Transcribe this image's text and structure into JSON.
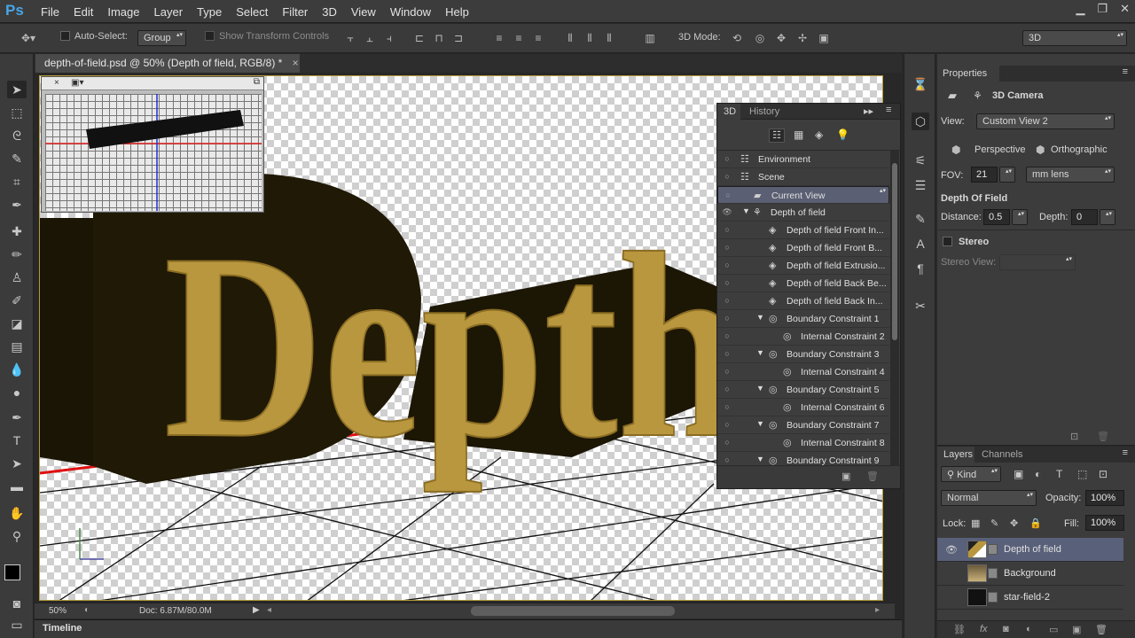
{
  "app": {
    "logo": "Ps"
  },
  "menu": [
    "File",
    "Edit",
    "Image",
    "Layer",
    "Type",
    "Select",
    "Filter",
    "3D",
    "View",
    "Window",
    "Help"
  ],
  "window_controls": {
    "minimize": "▁",
    "restore": "❐",
    "close": "✕"
  },
  "options_bar": {
    "auto_select_label": "Auto-Select:",
    "auto_select_value": "Group",
    "show_transform_label": "Show Transform Controls",
    "mode_label": "3D Mode:",
    "workspace": "3D"
  },
  "document": {
    "tab_title": "depth-of-field.psd @ 50% (Depth of field, RGB/8) *",
    "tab_close": "×",
    "zoom": "50%",
    "doc_info": "Doc: 6.87M/80.0M",
    "canvas_text": "Depth"
  },
  "timeline_label": "Timeline",
  "panel3d": {
    "tabs": [
      "3D",
      "History"
    ],
    "rows": [
      {
        "label": "Environment",
        "indent": 0,
        "twirl": "",
        "icon": "env",
        "eye": false,
        "selected": false
      },
      {
        "label": "Scene",
        "indent": 0,
        "twirl": "",
        "icon": "scene",
        "eye": false,
        "selected": false
      },
      {
        "label": "Current View",
        "indent": 1,
        "twirl": "",
        "icon": "cam",
        "eye": false,
        "selected": true
      },
      {
        "label": "Depth of field",
        "indent": 1,
        "twirl": "▼",
        "icon": "mesh",
        "eye": true,
        "selected": false
      },
      {
        "label": "Depth of field Front In...",
        "indent": 2,
        "twirl": "",
        "icon": "mat",
        "eye": false,
        "selected": false
      },
      {
        "label": "Depth of field Front B...",
        "indent": 2,
        "twirl": "",
        "icon": "mat",
        "eye": false,
        "selected": false
      },
      {
        "label": "Depth of field Extrusio...",
        "indent": 2,
        "twirl": "",
        "icon": "mat",
        "eye": false,
        "selected": false
      },
      {
        "label": "Depth of field Back Be...",
        "indent": 2,
        "twirl": "",
        "icon": "mat",
        "eye": false,
        "selected": false
      },
      {
        "label": "Depth of field Back In...",
        "indent": 2,
        "twirl": "",
        "icon": "mat",
        "eye": false,
        "selected": false
      },
      {
        "label": "Boundary Constraint 1",
        "indent": 2,
        "twirl": "▼",
        "icon": "con",
        "eye": false,
        "selected": false
      },
      {
        "label": "Internal Constraint 2",
        "indent": 3,
        "twirl": "",
        "icon": "con",
        "eye": false,
        "selected": false
      },
      {
        "label": "Boundary Constraint 3",
        "indent": 2,
        "twirl": "▼",
        "icon": "con",
        "eye": false,
        "selected": false
      },
      {
        "label": "Internal Constraint 4",
        "indent": 3,
        "twirl": "",
        "icon": "con",
        "eye": false,
        "selected": false
      },
      {
        "label": "Boundary Constraint 5",
        "indent": 2,
        "twirl": "▼",
        "icon": "con",
        "eye": false,
        "selected": false
      },
      {
        "label": "Internal Constraint 6",
        "indent": 3,
        "twirl": "",
        "icon": "con",
        "eye": false,
        "selected": false
      },
      {
        "label": "Boundary Constraint 7",
        "indent": 2,
        "twirl": "▼",
        "icon": "con",
        "eye": false,
        "selected": false
      },
      {
        "label": "Internal Constraint 8",
        "indent": 3,
        "twirl": "",
        "icon": "con",
        "eye": false,
        "selected": false
      },
      {
        "label": "Boundary Constraint 9",
        "indent": 2,
        "twirl": "▼",
        "icon": "con",
        "eye": false,
        "selected": false
      }
    ]
  },
  "properties": {
    "title": "Properties",
    "section": "3D Camera",
    "view_label": "View:",
    "view_value": "Custom View 2",
    "perspective": "Perspective",
    "orthographic": "Orthographic",
    "fov_label": "FOV:",
    "fov_value": "21",
    "lens_value": "mm lens",
    "dof_title": "Depth Of Field",
    "distance_label": "Distance:",
    "distance_value": "0.5",
    "depth_label": "Depth:",
    "depth_value": "0",
    "stereo_label": "Stereo",
    "stereo_view_label": "Stereo View:"
  },
  "layers": {
    "tabs": [
      "Layers",
      "Channels"
    ],
    "kind": "Kind",
    "blend": "Normal",
    "opacity_label": "Opacity:",
    "opacity_value": "100%",
    "lock_label": "Lock:",
    "fill_label": "Fill:",
    "fill_value": "100%",
    "items": [
      {
        "name": "Depth of field",
        "visible": true,
        "active": true
      },
      {
        "name": "Background",
        "visible": false,
        "active": false
      },
      {
        "name": "star-field-2",
        "visible": false,
        "active": false
      }
    ]
  },
  "colors": {
    "accent": "#47a6e6",
    "selection": "#596079",
    "gold": "#b8973f",
    "letter_dark": "#1f1906"
  }
}
